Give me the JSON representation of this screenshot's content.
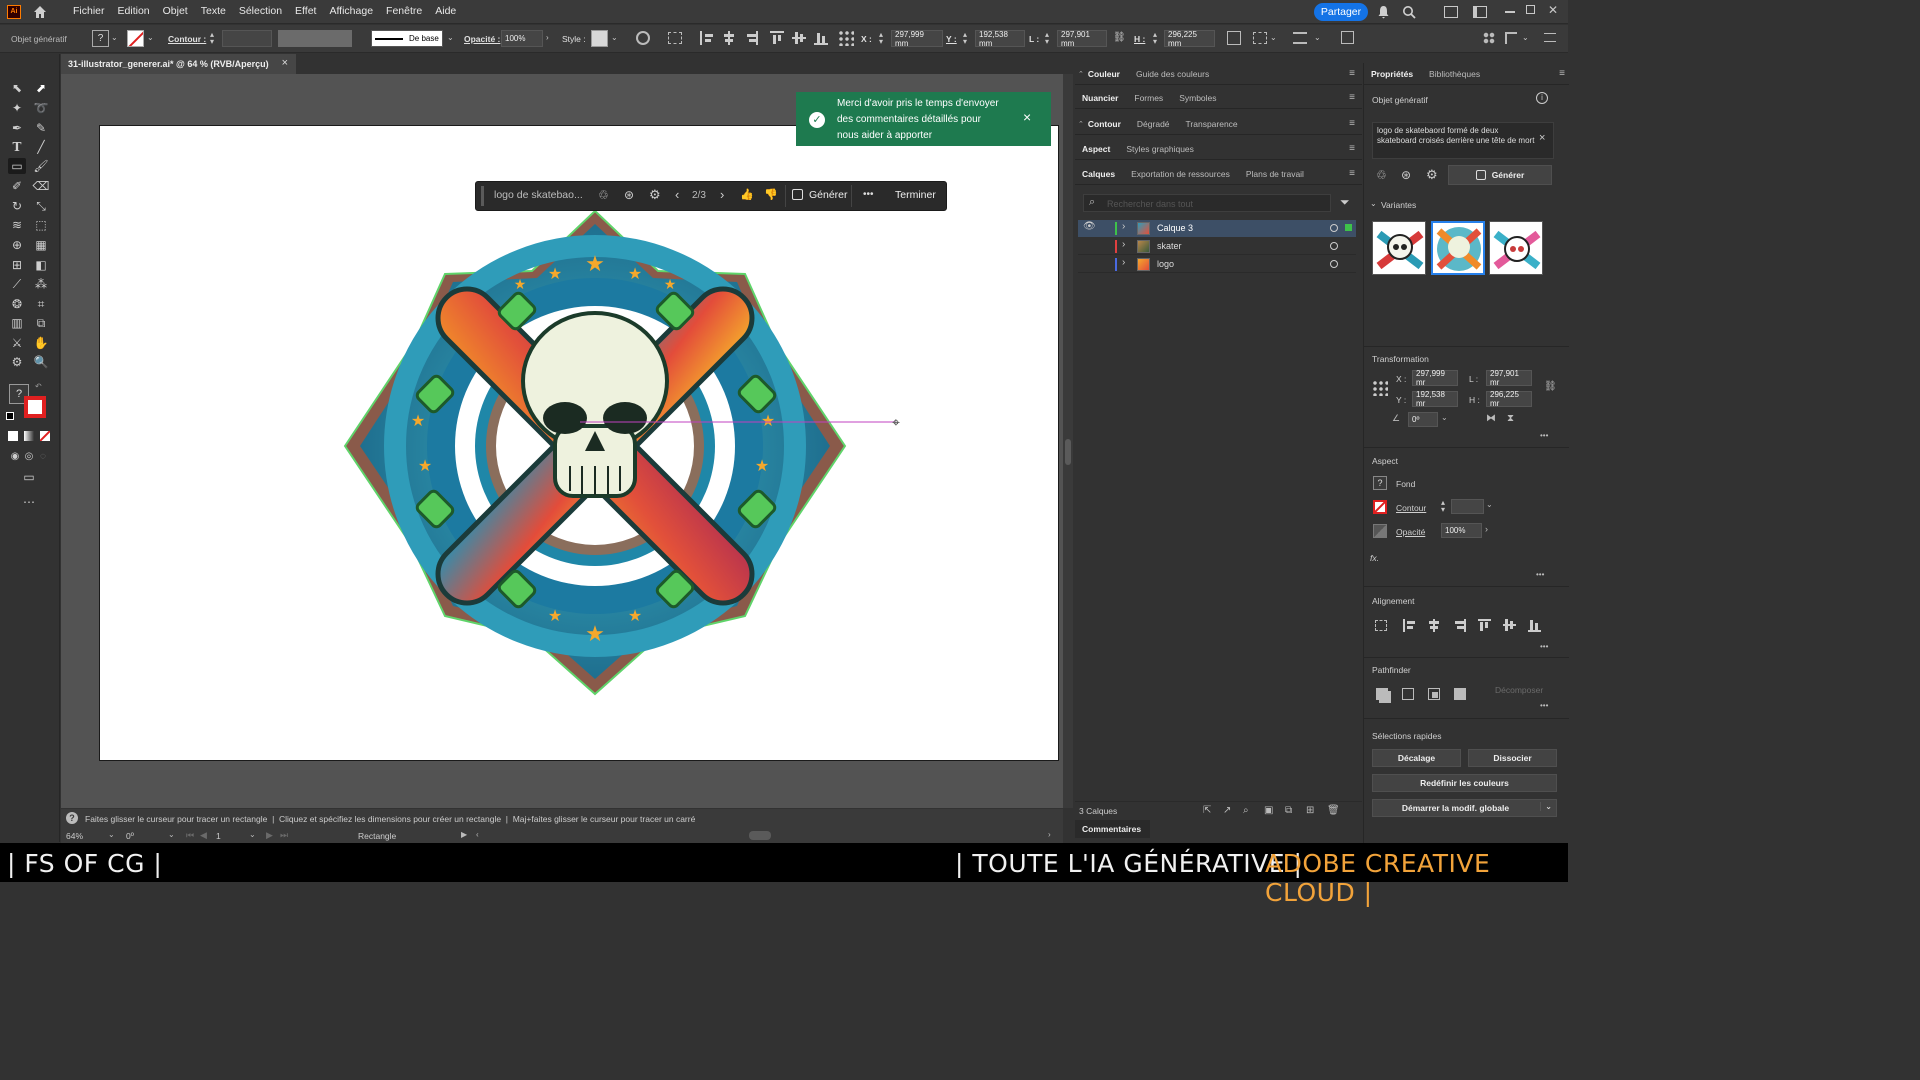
{
  "menubar": {
    "app_icon": "Ai",
    "items": [
      "Fichier",
      "Edition",
      "Objet",
      "Texte",
      "Sélection",
      "Effet",
      "Affichage",
      "Fenêtre",
      "Aide"
    ],
    "share_label": "Partager"
  },
  "controlbar": {
    "object_type": "Objet génératif",
    "contour_label": "Contour :",
    "stroke_profile": "De base",
    "opacity_label": "Opacité :",
    "opacity_value": "100%",
    "style_label": "Style :",
    "x_label": "X :",
    "x_value": "297,999 mm",
    "y_label": "Y :",
    "y_value": "192,538 mm",
    "w_label": "L :",
    "w_value": "297,901 mm",
    "h_label": "H :",
    "h_value": "296,225 mm"
  },
  "document": {
    "tab_title": "31-illustrator_generer.ai* @ 64 % (RVB/Aperçu)",
    "close": "×"
  },
  "toast": {
    "message": "Merci d'avoir pris le temps d'envoyer des commentaires détaillés pour nous aider à apporter",
    "close": "×"
  },
  "genbar": {
    "prompt": "logo de skatebao...",
    "counter": "2/3",
    "generate_label": "Générer",
    "more": "•••",
    "done_label": "Terminer"
  },
  "panels_mid": {
    "row1": [
      "Couleur",
      "Guide des couleurs"
    ],
    "row2": [
      "Nuancier",
      "Formes",
      "Symboles"
    ],
    "row3": [
      "Contour",
      "Dégradé",
      "Transparence"
    ],
    "row4": [
      "Aspect",
      "Styles graphiques"
    ],
    "row5": [
      "Calques",
      "Exportation de ressources",
      "Plans de travail"
    ],
    "search_placeholder": "Rechercher dans tout",
    "layers": [
      {
        "name": "Calque 3",
        "color": "#3ec24a",
        "selected": true
      },
      {
        "name": "skater",
        "color": "#e04040",
        "selected": false
      },
      {
        "name": "logo",
        "color": "#4a6ae0",
        "selected": false
      }
    ],
    "layers_count": "3 Calques",
    "comments_tab": "Commentaires"
  },
  "props": {
    "tabs": [
      "Propriétés",
      "Bibliothèques"
    ],
    "object_type": "Objet génératif",
    "prompt_text": "logo de skatebaord formé de deux skateboard croisés derrière une tête de mort",
    "generate_label": "Générer",
    "variants_label": "Variantes",
    "transform_label": "Transformation",
    "x_label": "X :",
    "x_value": "297,999 mr",
    "w_label": "L :",
    "w_value": "297,901 mr",
    "y_label": "Y :",
    "y_value": "192,538 mr",
    "h_label": "H :",
    "h_value": "296,225 mr",
    "angle_value": "0º",
    "aspect_label": "Aspect",
    "fill_label": "Fond",
    "stroke_label": "Contour",
    "opacity_label": "Opacité",
    "opacity_value": "100%",
    "fx_label": "fx.",
    "align_label": "Alignement",
    "pathfinder_label": "Pathfinder",
    "expand_label": "Décomposer",
    "quick_label": "Sélections rapides",
    "offset_btn": "Décalage",
    "ungroup_btn": "Dissocier",
    "recolor_btn": "Redéfinir les couleurs",
    "global_btn": "Démarrer la modif. globale"
  },
  "status": {
    "hint": "Faites glisser le curseur pour tracer un rectangle  |  Cliquez et spécifiez les dimensions pour créer un rectangle  |  Maj+faites glisser le curseur pour tracer un carré",
    "zoom": "64%",
    "rotation": "0º",
    "artboard_num": "1",
    "tool_name": "Rectangle"
  },
  "footer": {
    "left": "| FS OF CG |",
    "middle": "| TOUTE L'IA GÉNÉRATIVE |",
    "right": "ADOBE CREATIVE CLOUD |"
  },
  "colors": {
    "accent_blue": "#1473e6",
    "toast_green": "#1e7a4f",
    "footer_orange": "#f2a33a"
  }
}
